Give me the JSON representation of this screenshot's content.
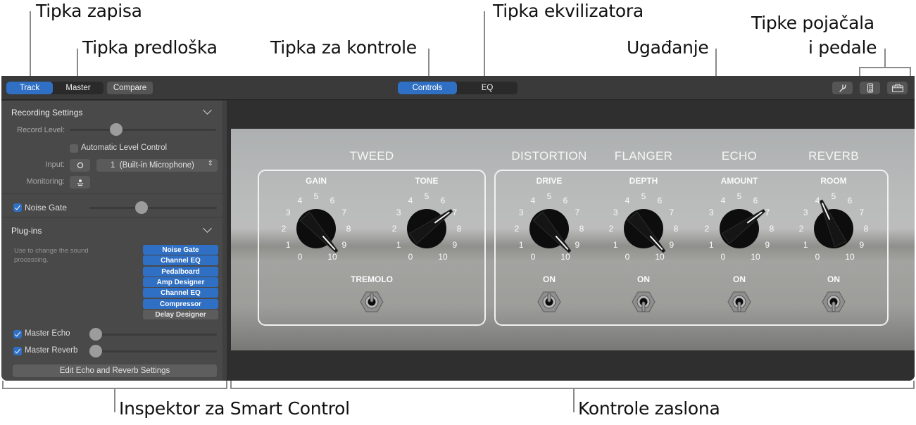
{
  "callouts": {
    "record_button": "Tipka zapisa",
    "template_button": "Tipka predloška",
    "controls_button": "Tipka za kontrole",
    "eq_button": "Tipka ekvilizatora",
    "tuner": "Ugađanje",
    "amp_pedal_buttons_line1": "Tipke pojačala",
    "amp_pedal_buttons_line2": "i pedale",
    "inspector": "Inspektor za Smart Control",
    "screen_controls": "Kontrole zaslona"
  },
  "toolbar": {
    "track_label": "Track",
    "master_label": "Master",
    "compare_label": "Compare",
    "controls_label": "Controls",
    "eq_label": "EQ",
    "selected_left": "Track",
    "selected_center": "Controls",
    "right_icons": [
      "tuner-fork-icon",
      "pedal-icon",
      "amp-icon"
    ]
  },
  "inspector": {
    "recording_settings": {
      "title": "Recording Settings",
      "record_level_label": "Record Level:",
      "record_level_value": 0.3,
      "auto_level_label": "Automatic Level Control",
      "auto_level_checked": false,
      "input_label": "Input:",
      "input_format_icon": "mono-circle-icon",
      "input_value": "1  (Built-in Microphone)",
      "monitoring_label": "Monitoring:",
      "monitoring_icon": "monitoring-icon"
    },
    "noise_gate": {
      "label": "Noise Gate",
      "checked": true,
      "value": 0.4
    },
    "plugins": {
      "title": "Plug-ins",
      "help": "Use to change the sound processing.",
      "items": [
        {
          "name": "Noise Gate",
          "active": true
        },
        {
          "name": "Channel EQ",
          "active": true
        },
        {
          "name": "Pedalboard",
          "active": true
        },
        {
          "name": "Amp Designer",
          "active": true
        },
        {
          "name": "Channel EQ",
          "active": true
        },
        {
          "name": "Compressor",
          "active": true
        },
        {
          "name": "Delay Designer",
          "active": false
        }
      ]
    },
    "master_echo": {
      "label": "Master Echo",
      "checked": true,
      "value": 0
    },
    "master_reverb": {
      "label": "Master Reverb",
      "checked": true,
      "value": 0
    },
    "edit_button": "Edit Echo and Reverb Settings"
  },
  "amp": {
    "scale": [
      "0",
      "1",
      "2",
      "3",
      "4",
      "5",
      "6",
      "7",
      "8",
      "9",
      "10"
    ],
    "groups": [
      {
        "title": "TWEED",
        "knobs": [
          {
            "label": "GAIN",
            "value": 9.6
          },
          {
            "label": "TONE",
            "value": 6.8
          }
        ],
        "switch": {
          "label": "TREMOLO",
          "on": false
        }
      },
      {
        "title": "DISTORTION",
        "knobs": [
          {
            "label": "DRIVE",
            "value": 9.6
          }
        ],
        "switch": {
          "label": "ON",
          "on": false
        }
      },
      {
        "title": "FLANGER",
        "knobs": [
          {
            "label": "DEPTH",
            "value": 9.6
          }
        ],
        "switch": {
          "label": "ON",
          "on": true
        }
      },
      {
        "title": "ECHO",
        "knobs": [
          {
            "label": "AMOUNT",
            "value": 6.8
          }
        ],
        "switch": {
          "label": "ON",
          "on": true
        }
      },
      {
        "title": "REVERB",
        "knobs": [
          {
            "label": "ROOM",
            "value": 4.2
          }
        ],
        "switch": {
          "label": "ON",
          "on": true
        }
      }
    ]
  },
  "colors": {
    "accent": "#2f6fc4",
    "toolbar": "#3a3a3a",
    "inspector": "#494949",
    "plugin_inactive": "#5c5c5c"
  }
}
